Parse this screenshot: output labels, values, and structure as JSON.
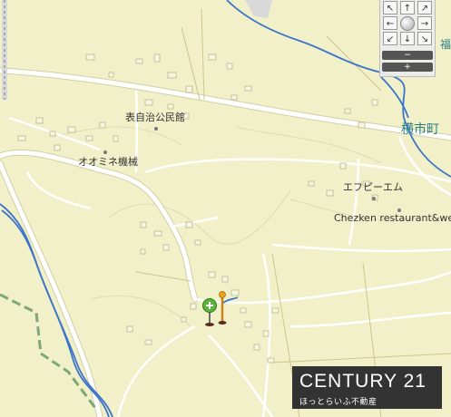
{
  "labels": {
    "hall": "表自治公民館",
    "ominekikai": "オオミネ機械",
    "fpm": "エフピーエム",
    "restaurant": "Chezken restaurant&wed",
    "town": "横市町",
    "fuku": "福"
  },
  "nav": {
    "up": "↑",
    "down": "↓",
    "left": "←",
    "right": "→",
    "upleft": "↖",
    "upright": "↗",
    "downleft": "↙",
    "downright": "↘",
    "zoom_out": "−",
    "zoom_in": "+"
  },
  "logo": {
    "brand": "CENTURY 21",
    "tagline": "ほっとらいふ不動産"
  },
  "colors": {
    "map_bg": "#f1f0c9",
    "road": "#ffffff",
    "river": "#3b74c9",
    "rail": "#7ea77a",
    "marker_green": "#5ab33a",
    "marker_orange": "#e8a31a"
  }
}
